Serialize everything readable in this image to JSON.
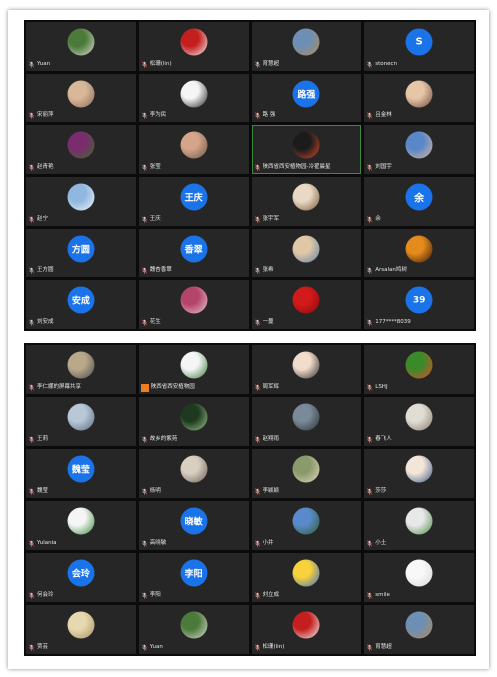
{
  "panels": [
    {
      "tiles": [
        {
          "name": "Yuan",
          "avatar": {
            "kind": "image",
            "c1": "#4c7a3a",
            "c2": "#d8d8d0"
          }
        },
        {
          "name": "松珊(lin)",
          "avatar": {
            "kind": "image",
            "c1": "#c41e1e",
            "c2": "#f2f2f2"
          }
        },
        {
          "name": "育慧超",
          "avatar": {
            "kind": "image",
            "c1": "#6d8fb5",
            "c2": "#b48a55"
          }
        },
        {
          "name": "stonecn",
          "avatar": {
            "kind": "text",
            "text": "S"
          }
        },
        {
          "name": "宋丽萍",
          "avatar": {
            "kind": "image",
            "c1": "#d9b89a",
            "c2": "#8a6a55"
          }
        },
        {
          "name": "李为民",
          "avatar": {
            "kind": "image",
            "c1": "#f5f5f5",
            "c2": "#222222"
          }
        },
        {
          "name": "路 强",
          "avatar": {
            "kind": "text",
            "text": "路强"
          }
        },
        {
          "name": "吕金林",
          "avatar": {
            "kind": "image",
            "c1": "#e7c6a8",
            "c2": "#6e4b3a"
          }
        },
        {
          "name": "赵青艳",
          "avatar": {
            "kind": "image",
            "c1": "#7a2c6e",
            "c2": "#3c6a2a"
          }
        },
        {
          "name": "张莹",
          "avatar": {
            "kind": "image",
            "c1": "#d4a58a",
            "c2": "#6a5548"
          }
        },
        {
          "name": "陕西省西安植物园-冷翟晨星",
          "avatar": {
            "kind": "image",
            "c1": "#1b1b1b",
            "c2": "#d94a2a"
          },
          "selected": true
        },
        {
          "name": "刘国宇",
          "avatar": {
            "kind": "image",
            "c1": "#5a87c8",
            "c2": "#d6b89a"
          }
        },
        {
          "name": "赵宁",
          "avatar": {
            "kind": "image",
            "c1": "#8fb7e0",
            "c2": "#f0f4f8"
          }
        },
        {
          "name": "王庆",
          "avatar": {
            "kind": "text",
            "text": "王庆"
          }
        },
        {
          "name": "张宇军",
          "avatar": {
            "kind": "image",
            "c1": "#e9d9c4",
            "c2": "#7a5a3a"
          }
        },
        {
          "name": "余",
          "avatar": {
            "kind": "text",
            "text": "余"
          }
        },
        {
          "name": "王方圆",
          "avatar": {
            "kind": "text",
            "text": "方圆"
          }
        },
        {
          "name": "魏杏香翠",
          "avatar": {
            "kind": "text",
            "text": "香翠"
          }
        },
        {
          "name": "张希",
          "avatar": {
            "kind": "image",
            "c1": "#e0c7a5",
            "c2": "#5d82a8"
          }
        },
        {
          "name": "Arsalan鸠树",
          "avatar": {
            "kind": "image",
            "c1": "#e48b1e",
            "c2": "#3a1a0a"
          }
        },
        {
          "name": "刘安成",
          "avatar": {
            "kind": "text",
            "text": "安成"
          }
        },
        {
          "name": "花生",
          "avatar": {
            "kind": "image",
            "c1": "#b4456a",
            "c2": "#e8c4d0"
          }
        },
        {
          "name": "一蔓",
          "avatar": {
            "kind": "image",
            "c1": "#d11a1a",
            "c2": "#8a0a0a"
          }
        },
        {
          "name": "177****8039",
          "avatar": {
            "kind": "text",
            "text": "39"
          }
        }
      ]
    },
    {
      "tiles": [
        {
          "name": "李仁娜的屏幕共享",
          "avatar": {
            "kind": "image",
            "c1": "#b9a98a",
            "c2": "#4a4a4a"
          },
          "share": true
        },
        {
          "name": "陕西省西安植物园",
          "avatar": {
            "kind": "image",
            "c1": "#f5f5f5",
            "c2": "#3a7a3a"
          },
          "org": true
        },
        {
          "name": "周军辉",
          "avatar": {
            "kind": "image",
            "c1": "#f2dccc",
            "c2": "#2a2a2a"
          }
        },
        {
          "name": "LSHJ",
          "avatar": {
            "kind": "image",
            "c1": "#3a8a2a",
            "c2": "#e44a2a"
          }
        },
        {
          "name": "王莉",
          "avatar": {
            "kind": "image",
            "c1": "#b8c8d8",
            "c2": "#5a6a7a"
          },
          "share": true
        },
        {
          "name": "故乡的紫苑",
          "avatar": {
            "kind": "image",
            "c1": "#1e3a1e",
            "c2": "#9ac28a"
          }
        },
        {
          "name": "赵翔雨",
          "avatar": {
            "kind": "image",
            "c1": "#7a8a98",
            "c2": "#2a3038"
          }
        },
        {
          "name": "春飞人",
          "avatar": {
            "kind": "image",
            "c1": "#e0ddd5",
            "c2": "#8a7a6a"
          }
        },
        {
          "name": "魏莹",
          "avatar": {
            "kind": "text",
            "text": "魏莹"
          }
        },
        {
          "name": "栎明",
          "avatar": {
            "kind": "image",
            "c1": "#d8cfc0",
            "c2": "#6a6055"
          }
        },
        {
          "name": "李颖颖",
          "avatar": {
            "kind": "image",
            "c1": "#8a9a6a",
            "c2": "#e2d6c0"
          }
        },
        {
          "name": "莎莎",
          "avatar": {
            "kind": "image",
            "c1": "#f3e6d8",
            "c2": "#3a5a8a"
          }
        },
        {
          "name": "Yulania",
          "avatar": {
            "kind": "image",
            "c1": "#f5f5f5",
            "c2": "#3a8a3a"
          }
        },
        {
          "name": "高晓敏",
          "avatar": {
            "kind": "text",
            "text": "晓敏"
          }
        },
        {
          "name": "小井",
          "avatar": {
            "kind": "image",
            "c1": "#5a8acb",
            "c2": "#2f5a2a"
          }
        },
        {
          "name": "小土",
          "avatar": {
            "kind": "image",
            "c1": "#e8e8e8",
            "c2": "#4a8a4a"
          }
        },
        {
          "name": "何会玲",
          "avatar": {
            "kind": "text",
            "text": "会玲"
          }
        },
        {
          "name": "李阳",
          "avatar": {
            "kind": "text",
            "text": "李阳"
          }
        },
        {
          "name": "刘立成",
          "avatar": {
            "kind": "image",
            "c1": "#f7d23a",
            "c2": "#3a6ac8"
          }
        },
        {
          "name": "smile",
          "avatar": {
            "kind": "image",
            "c1": "#f8f8f8",
            "c2": "#d8d8d8"
          }
        },
        {
          "name": "贾芸",
          "avatar": {
            "kind": "image",
            "c1": "#e8d8b0",
            "c2": "#a89060"
          }
        },
        {
          "name": "Yuan",
          "avatar": {
            "kind": "image",
            "c1": "#4c7a3a",
            "c2": "#d8d8d0"
          }
        },
        {
          "name": "松珊(lin)",
          "avatar": {
            "kind": "image",
            "c1": "#c41e1e",
            "c2": "#f2f2f2"
          }
        },
        {
          "name": "育慧超",
          "avatar": {
            "kind": "image",
            "c1": "#6d8fb5",
            "c2": "#b48a55"
          }
        }
      ]
    }
  ],
  "colors": {
    "grid_bg": "#0b0b0b",
    "tile_bg": "#262626",
    "text_avatar": "#1a73e8",
    "active_speaker": "#3c8b3c",
    "mic_icon": "#cfcfcf"
  }
}
